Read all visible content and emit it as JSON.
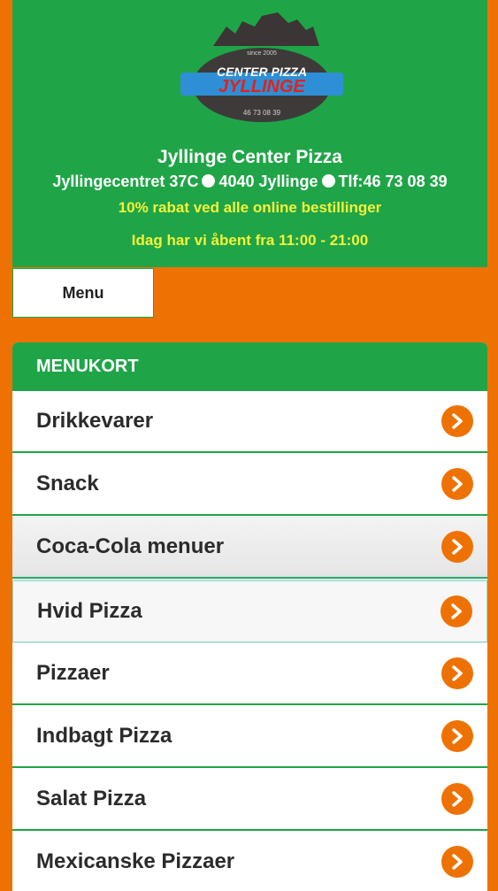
{
  "header": {
    "title": "Jyllinge Center Pizza",
    "address": "Jyllingecentret 37C",
    "postal": "4040 Jyllinge",
    "phone": "Tlf:46 73 08 39",
    "promo": "10% rabat ved alle online bestillinger",
    "hours": "Idag har vi åbent fra 11:00 - 21:00",
    "logo": {
      "since": "since 2005",
      "line1": "CENTER PIZZA",
      "line2": "JYLLINGE",
      "phone": "46 73 08 39"
    }
  },
  "nav": {
    "menu_label": "Menu"
  },
  "menukort": {
    "heading": "MENUKORT",
    "items": [
      {
        "label": "Drikkevarer"
      },
      {
        "label": "Snack"
      },
      {
        "label": "Coca-Cola menuer"
      },
      {
        "label": "Hvid Pizza"
      },
      {
        "label": "Pizzaer"
      },
      {
        "label": "Indbagt Pizza"
      },
      {
        "label": "Salat Pizza"
      },
      {
        "label": "Mexicanske Pizzaer"
      }
    ]
  },
  "colors": {
    "brand_green": "#1FA547",
    "background_orange": "#EE7203",
    "promo_yellow": "#F3F23A"
  },
  "icons": {
    "item_arrow": "chevron-right-circle-icon"
  }
}
